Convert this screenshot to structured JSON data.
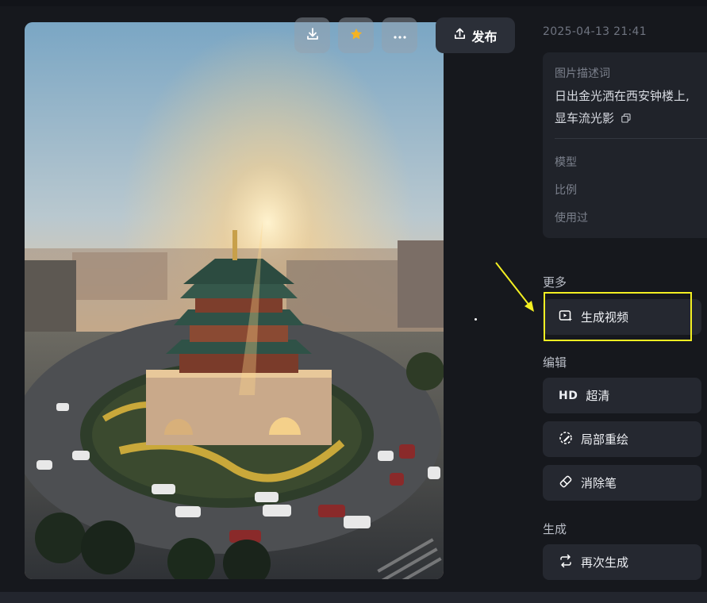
{
  "toolbar": {
    "download_icon": "download-icon",
    "favorite_icon": "star-icon",
    "more_icon": "more-icon",
    "publish_label": "发布"
  },
  "meta": {
    "timestamp": "2025-04-13 21:41"
  },
  "info": {
    "description_label": "图片描述词",
    "description_text_line1": "日出金光洒在西安钟楼上,",
    "description_text_line2": "显车流光影",
    "model_label": "模型",
    "ratio_label": "比例",
    "used_label": "使用过"
  },
  "sections": {
    "more": {
      "title": "更多",
      "generate_video_label": "生成视频"
    },
    "edit": {
      "title": "编辑",
      "hd_badge": "HD",
      "upscale_label": "超清",
      "inpaint_label": "局部重绘",
      "eraser_label": "消除笔"
    },
    "generate": {
      "title": "生成",
      "regenerate_label": "再次生成"
    }
  },
  "colors": {
    "highlight": "#f3ef22",
    "favorite_star": "#f5b321"
  }
}
